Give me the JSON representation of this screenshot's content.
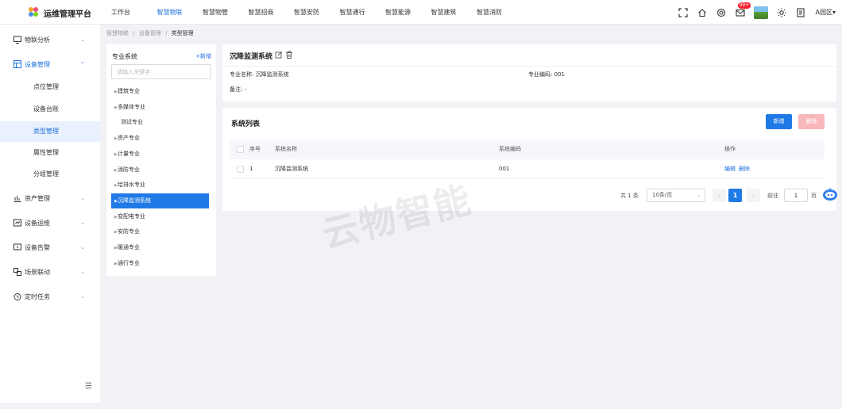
{
  "header": {
    "app_title": "运维管理平台",
    "nav": [
      "工作台",
      "智慧物联",
      "智慧物管",
      "智慧招商",
      "智慧安防",
      "智慧通行",
      "智慧能源",
      "智慧建筑",
      "智慧消防"
    ],
    "active_nav": "智慧物联",
    "notification_badge": "99+",
    "area": "A园区",
    "area_arrow": "▾",
    "accent_color": "#1f6fe0"
  },
  "sidebar": {
    "items": [
      {
        "label": "物联分析",
        "icon": "monitor-icon"
      },
      {
        "label": "设备管理",
        "icon": "device-icon",
        "open": true
      },
      {
        "label": "资产管理",
        "icon": "chart-icon"
      },
      {
        "label": "设备运维",
        "icon": "maintenance-icon"
      },
      {
        "label": "设备告警",
        "icon": "alarm-icon"
      },
      {
        "label": "场景联动",
        "icon": "scene-icon"
      },
      {
        "label": "定时任务",
        "icon": "clock-icon"
      }
    ],
    "sub_items": [
      "点位管理",
      "设备台账",
      "类型管理",
      "属性管理",
      "分组管理"
    ],
    "active_sub": "类型管理"
  },
  "breadcrumb": {
    "items": [
      "智慧物联",
      "设备管理"
    ],
    "current": "类型管理",
    "separator": "/"
  },
  "tree": {
    "title": "专业系统",
    "add_label": "+新增",
    "search_placeholder": "请输入关键字",
    "nodes": [
      {
        "label": "建筑专业",
        "arrow": true
      },
      {
        "label": "多媒体专业",
        "arrow": true
      },
      {
        "label": "测试专业",
        "arrow": false
      },
      {
        "label": "资产专业",
        "arrow": true
      },
      {
        "label": "计量专业",
        "arrow": true
      },
      {
        "label": "消防专业",
        "arrow": true
      },
      {
        "label": "给排水专业",
        "arrow": true
      },
      {
        "label": "沉降监测系统",
        "arrow": true,
        "active": true
      },
      {
        "label": "变配电专业",
        "arrow": true
      },
      {
        "label": "安防专业",
        "arrow": true
      },
      {
        "label": "暖通专业",
        "arrow": true
      },
      {
        "label": "通行专业",
        "arrow": true
      }
    ]
  },
  "detail": {
    "title": "沉降监测系统",
    "name_label": "专业名称:",
    "name_value": "沉降监测系统",
    "code_label": "专业编码:",
    "code_value": "001",
    "remark_label": "备注:",
    "remark_value": "-"
  },
  "list": {
    "title": "系统列表",
    "new_button": "新增",
    "delete_button": "删除",
    "columns": [
      "序号",
      "系统名称",
      "系统编码",
      "操作"
    ],
    "rows": [
      {
        "index": "1",
        "name": "沉降监测系统",
        "code": "001",
        "actions": [
          "编辑",
          "删除"
        ]
      }
    ],
    "pagination": {
      "total": "共 1 条",
      "page_size": "10条/页",
      "current_page": "1",
      "goto_label": "前往",
      "goto_value": "1",
      "page_suffix": "页"
    }
  },
  "watermark": "云物智能"
}
